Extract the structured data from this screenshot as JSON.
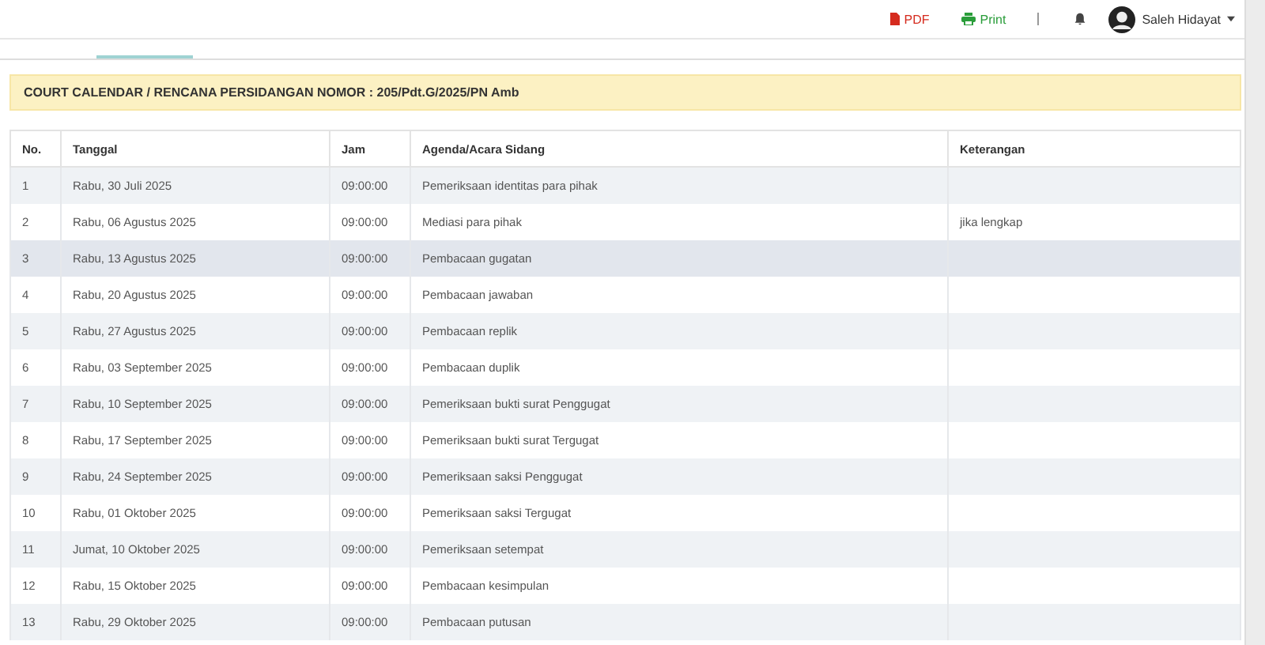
{
  "topbar": {
    "pdf": "PDF",
    "print": "Print",
    "user": "Saleh Hidayat"
  },
  "title": "COURT CALENDAR / RENCANA PERSIDANGAN NOMOR : 205/Pdt.G/2025/PN Amb",
  "table": {
    "columns": [
      "No.",
      "Tanggal",
      "Jam",
      "Agenda/Acara Sidang",
      "Keterangan"
    ],
    "rows": [
      {
        "cells": [
          "1",
          "Rabu, 30 Juli 2025",
          "09:00:00",
          "Pemeriksaan identitas para pihak",
          ""
        ],
        "selected": false
      },
      {
        "cells": [
          "2",
          "Rabu, 06 Agustus 2025",
          "09:00:00",
          "Mediasi para pihak",
          "jika lengkap"
        ],
        "selected": false
      },
      {
        "cells": [
          "3",
          "Rabu, 13 Agustus 2025",
          "09:00:00",
          "Pembacaan gugatan",
          ""
        ],
        "selected": true
      },
      {
        "cells": [
          "4",
          "Rabu, 20 Agustus 2025",
          "09:00:00",
          "Pembacaan jawaban",
          ""
        ],
        "selected": false
      },
      {
        "cells": [
          "5",
          "Rabu, 27 Agustus 2025",
          "09:00:00",
          "Pembacaan replik",
          ""
        ],
        "selected": false
      },
      {
        "cells": [
          "6",
          "Rabu, 03 September 2025",
          "09:00:00",
          "Pembacaan duplik",
          ""
        ],
        "selected": false
      },
      {
        "cells": [
          "7",
          "Rabu, 10 September 2025",
          "09:00:00",
          "Pemeriksaan bukti surat Penggugat",
          ""
        ],
        "selected": false
      },
      {
        "cells": [
          "8",
          "Rabu, 17 September 2025",
          "09:00:00",
          "Pemeriksaan bukti surat Tergugat",
          ""
        ],
        "selected": false
      },
      {
        "cells": [
          "9",
          "Rabu, 24 September 2025",
          "09:00:00",
          "Pemeriksaan saksi Penggugat",
          ""
        ],
        "selected": false
      },
      {
        "cells": [
          "10",
          "Rabu, 01 Oktober 2025",
          "09:00:00",
          "Pemeriksaan saksi Tergugat",
          ""
        ],
        "selected": false
      },
      {
        "cells": [
          "11",
          "Jumat, 10 Oktober 2025",
          "09:00:00",
          "Pemeriksaan setempat",
          ""
        ],
        "selected": false
      },
      {
        "cells": [
          "12",
          "Rabu, 15 Oktober 2025",
          "09:00:00",
          "Pembacaan kesimpulan",
          ""
        ],
        "selected": false
      },
      {
        "cells": [
          "13",
          "Rabu, 29 Oktober 2025",
          "09:00:00",
          "Pembacaan putusan",
          ""
        ],
        "selected": false
      }
    ]
  }
}
